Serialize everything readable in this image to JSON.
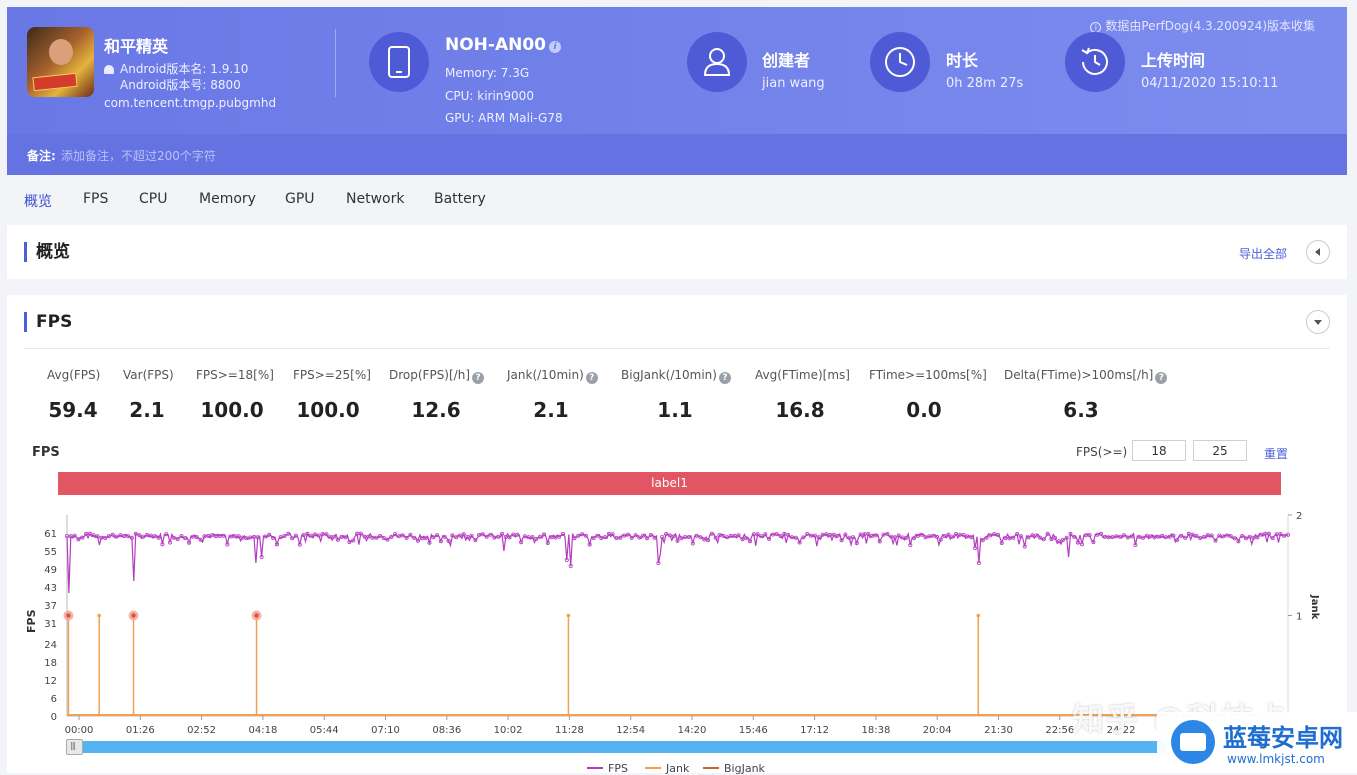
{
  "header": {
    "collect_note": "数据由PerfDog(4.3.200924)版本收集",
    "app": {
      "name": "和平精英",
      "version_name": "Android版本名: 1.9.10",
      "version_code": "Android版本号: 8800",
      "package": "com.tencent.tmgp.pubgmhd"
    },
    "device": {
      "name": "NOH-AN00",
      "memory": "Memory: 7.3G",
      "cpu": "CPU: kirin9000",
      "gpu": "GPU: ARM Mali-G78"
    },
    "creator": {
      "title": "创建者",
      "value": "jian wang"
    },
    "duration": {
      "title": "时长",
      "value": "0h 28m 27s"
    },
    "upload": {
      "title": "上传时间",
      "value": "04/11/2020 15:10:11"
    },
    "note_label": "备注:",
    "note_placeholder": "添加备注，不超过200个字符"
  },
  "tabs": [
    "概览",
    "FPS",
    "CPU",
    "Memory",
    "GPU",
    "Network",
    "Battery"
  ],
  "overview": {
    "title": "概览",
    "export_label": "导出全部"
  },
  "fps_panel": {
    "title": "FPS",
    "stats": [
      {
        "label": "Avg(FPS)",
        "value": "59.4",
        "help": false
      },
      {
        "label": "Var(FPS)",
        "value": "2.1",
        "help": false
      },
      {
        "label": "FPS>=18[%]",
        "value": "100.0",
        "help": false
      },
      {
        "label": "FPS>=25[%]",
        "value": "100.0",
        "help": false
      },
      {
        "label": "Drop(FPS)[/h]",
        "value": "12.6",
        "help": true
      },
      {
        "label": "Jank(/10min)",
        "value": "2.1",
        "help": true
      },
      {
        "label": "BigJank(/10min)",
        "value": "1.1",
        "help": true
      },
      {
        "label": "Avg(FTime)[ms]",
        "value": "16.8",
        "help": false
      },
      {
        "label": "FTime>=100ms[%]",
        "value": "0.0",
        "help": false
      },
      {
        "label": "Delta(FTime)>100ms[/h]",
        "value": "6.3",
        "help": true
      }
    ],
    "chart_title": "FPS",
    "threshold_label": "FPS(>=)",
    "threshold_low": "18",
    "threshold_high": "25",
    "reset_label": "重置",
    "label_bar": "label1"
  },
  "chart_data": {
    "type": "line",
    "title": "FPS",
    "ylabel": "FPS",
    "y2label": "Jank",
    "ylim": [
      0,
      61
    ],
    "y2lim": [
      0,
      2
    ],
    "y_ticks": [
      "0",
      "6",
      "12",
      "18",
      "24",
      "31",
      "37",
      "43",
      "49",
      "55",
      "61"
    ],
    "y2_ticks": [
      "1",
      "2"
    ],
    "x_ticks": [
      "00:00",
      "01:26",
      "02:52",
      "04:18",
      "05:44",
      "07:10",
      "08:36",
      "10:02",
      "11:28",
      "12:54",
      "14:20",
      "15:46",
      "17:12",
      "18:38",
      "20:04",
      "21:30",
      "22:56",
      "24:22"
    ],
    "x_range_seconds": [
      0,
      1707
    ],
    "series": [
      {
        "name": "FPS",
        "color": "#b43cc0",
        "baseline": 60,
        "dips": [
          {
            "t": 2,
            "fps": 41
          },
          {
            "t": 45,
            "fps": 57
          },
          {
            "t": 93,
            "fps": 45
          },
          {
            "t": 265,
            "fps": 51
          },
          {
            "t": 272,
            "fps": 53
          },
          {
            "t": 610,
            "fps": 55
          },
          {
            "t": 700,
            "fps": 52
          },
          {
            "t": 703,
            "fps": 50
          },
          {
            "t": 830,
            "fps": 54
          },
          {
            "t": 826,
            "fps": 51
          },
          {
            "t": 1180,
            "fps": 57
          },
          {
            "t": 1270,
            "fps": 56
          },
          {
            "t": 1274,
            "fps": 51
          },
          {
            "t": 1400,
            "fps": 53
          },
          {
            "t": 1550,
            "fps": 58
          }
        ]
      },
      {
        "name": "Jank",
        "color": "#f0a050",
        "events": [
          2,
          45,
          93,
          265,
          701,
          1274
        ]
      },
      {
        "name": "BigJank",
        "color": "#c06a30",
        "events": [
          2,
          93,
          265
        ]
      }
    ]
  },
  "watermark": {
    "zhihu": "知乎 @科技卡",
    "site": "蓝莓安卓网",
    "url": "www.lmkjst.com"
  }
}
